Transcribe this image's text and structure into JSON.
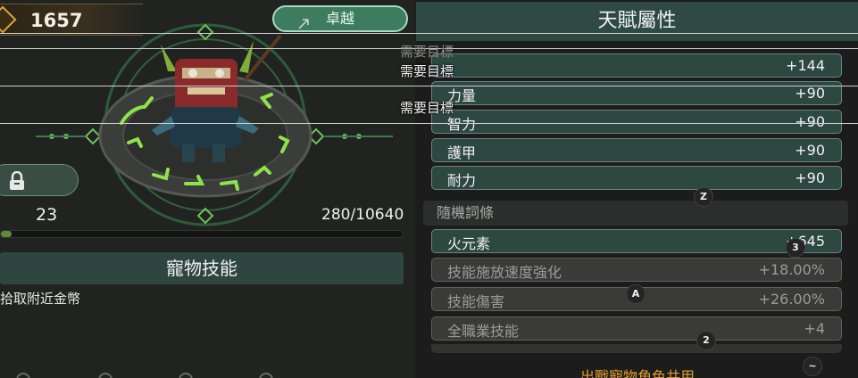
{
  "currency": {
    "value": "1657",
    "icon": "gold-gear-icon"
  },
  "pet": {
    "level": "23",
    "exp": "280/10640",
    "exp_progress": 0.026,
    "lock_icon": "lock-icon"
  },
  "pet_skill": {
    "header": "寵物技能",
    "description": "拾取附近金幣"
  },
  "tabs": {
    "excellence": "卓越"
  },
  "talent": {
    "header": "天賦屬性",
    "stats": [
      {
        "name": "",
        "value": "+144"
      },
      {
        "name": "力量",
        "value": "+90"
      },
      {
        "name": "智力",
        "value": "+90"
      },
      {
        "name": "護甲",
        "value": "+90"
      },
      {
        "name": "耐力",
        "value": "+90"
      }
    ]
  },
  "random_affixes": {
    "header": "隨機詞條",
    "items": [
      {
        "name": "火元素",
        "value": "+645",
        "active": true
      },
      {
        "name": "技能施放速度強化",
        "value": "+18.00%",
        "active": false
      },
      {
        "name": "技能傷害",
        "value": "+26.00%",
        "active": false
      },
      {
        "name": "全職業技能",
        "value": "+4",
        "active": false
      }
    ]
  },
  "overlay": {
    "requirement_label": "需要目標"
  },
  "shared_caption": "出戰寵物角色共用",
  "hints": {
    "z": "Z",
    "three": "3",
    "a": "A",
    "two": "2",
    "tilde": "~"
  },
  "colors": {
    "accent_green": "#3d7c5e",
    "stat_row": "#2d4741",
    "gold": "#d9a63b",
    "caption_orange": "#e09a35",
    "rune_glow": "#8fe34a"
  }
}
